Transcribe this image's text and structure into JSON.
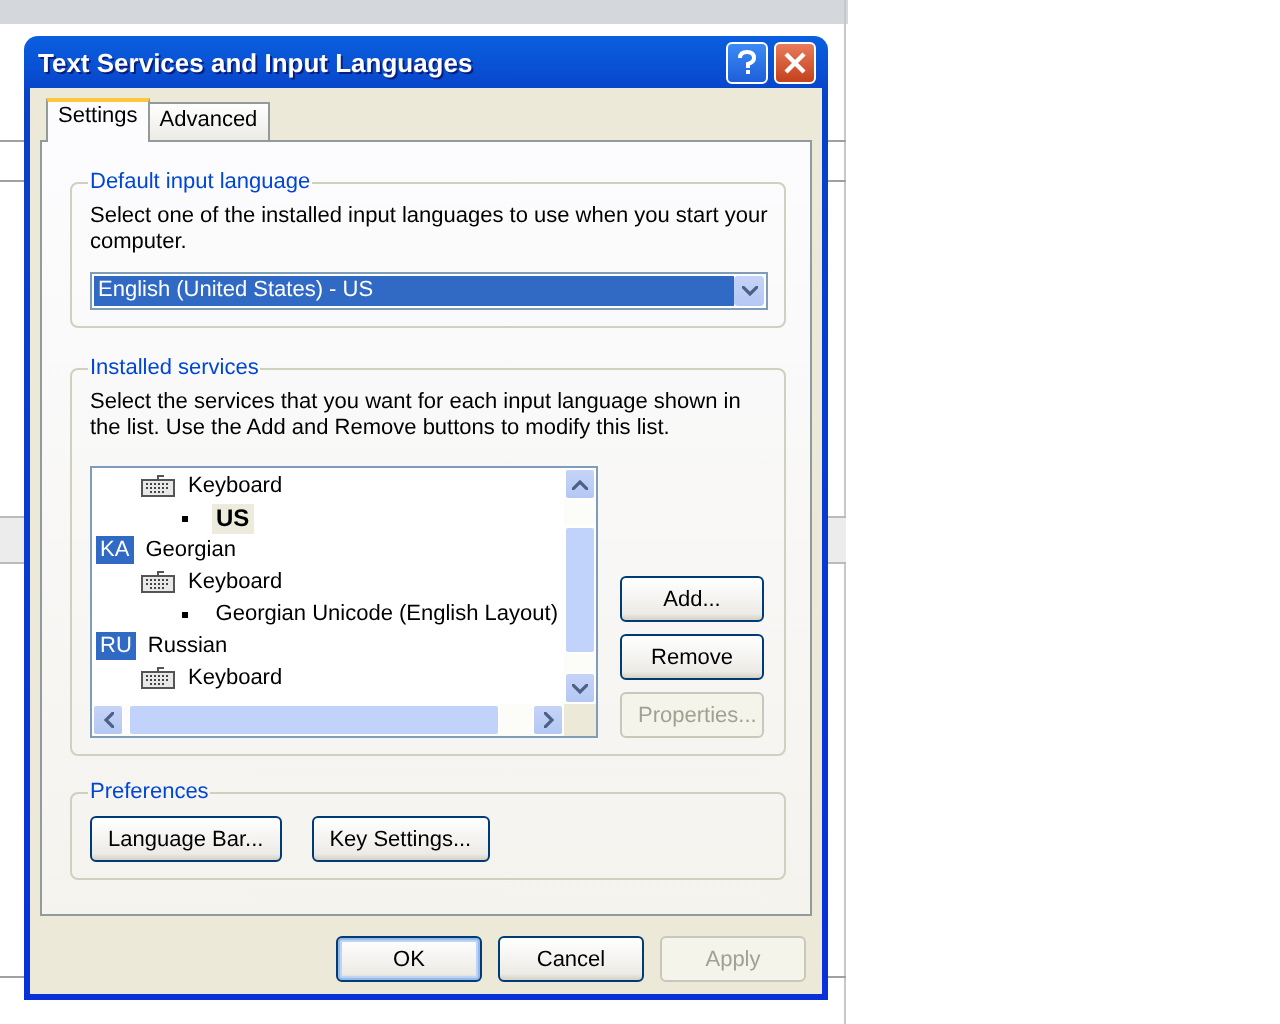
{
  "window": {
    "title": "Text Services and Input Languages"
  },
  "tabs": [
    {
      "label": "Settings",
      "selected": true
    },
    {
      "label": "Advanced",
      "selected": false
    }
  ],
  "default_input_language": {
    "title": "Default input language",
    "description": "Select one of the installed input languages to use when you start your computer.",
    "value": "English (United States) - US"
  },
  "installed_services": {
    "title": "Installed services",
    "description": "Select the services that you want for each input language shown in the list. Use the Add and Remove buttons to modify this list.",
    "tree": [
      {
        "kind": "category",
        "label": "Keyboard",
        "children": [
          {
            "kind": "layout",
            "label": "US",
            "selected": true
          }
        ]
      },
      {
        "kind": "language",
        "badge": "KA",
        "label": "Georgian",
        "children": [
          {
            "kind": "category",
            "label": "Keyboard",
            "children": [
              {
                "kind": "layout",
                "label": "Georgian Unicode (English Layout)",
                "selected": false
              }
            ]
          }
        ]
      },
      {
        "kind": "language",
        "badge": "RU",
        "label": "Russian",
        "children": [
          {
            "kind": "category",
            "label": "Keyboard"
          }
        ]
      }
    ],
    "buttons": [
      {
        "label": "Add...",
        "disabled": false
      },
      {
        "label": "Remove",
        "disabled": false
      },
      {
        "label": "Properties...",
        "disabled": true
      }
    ]
  },
  "preferences": {
    "title": "Preferences",
    "buttons": [
      {
        "label": "Language Bar...",
        "disabled": false
      },
      {
        "label": "Key Settings...",
        "disabled": false
      }
    ]
  },
  "dialog_buttons": [
    {
      "label": "OK",
      "disabled": false,
      "default": true
    },
    {
      "label": "Cancel",
      "disabled": false,
      "default": false
    },
    {
      "label": "Apply",
      "disabled": true,
      "default": false
    }
  ]
}
